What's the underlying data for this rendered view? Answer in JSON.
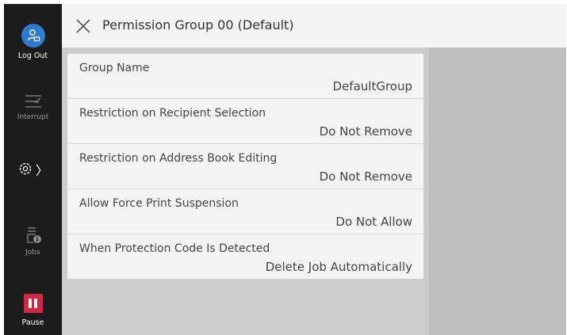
{
  "sidebar": {
    "logout_label": "Log Out",
    "interrupt_label": "Interrupt",
    "jobs_label": "Jobs",
    "pause_label": "Pause",
    "settings_chevron": "〉"
  },
  "header": {
    "title": "Permission Group 00 (Default)"
  },
  "rows": [
    {
      "label": "Group Name",
      "value": "DefaultGroup"
    },
    {
      "label": "Restriction on Recipient Selection",
      "value": "Do Not Remove"
    },
    {
      "label": "Restriction on Address Book Editing",
      "value": "Do Not Remove"
    },
    {
      "label": "Allow Force Print Suspension",
      "value": "Do Not Allow"
    },
    {
      "label": "When Protection Code Is Detected",
      "value": "Delete Job Automatically"
    }
  ],
  "colors": {
    "accent": "#2e7bd1",
    "pause": "#d62643",
    "sidebar": "#1c1c1c"
  }
}
